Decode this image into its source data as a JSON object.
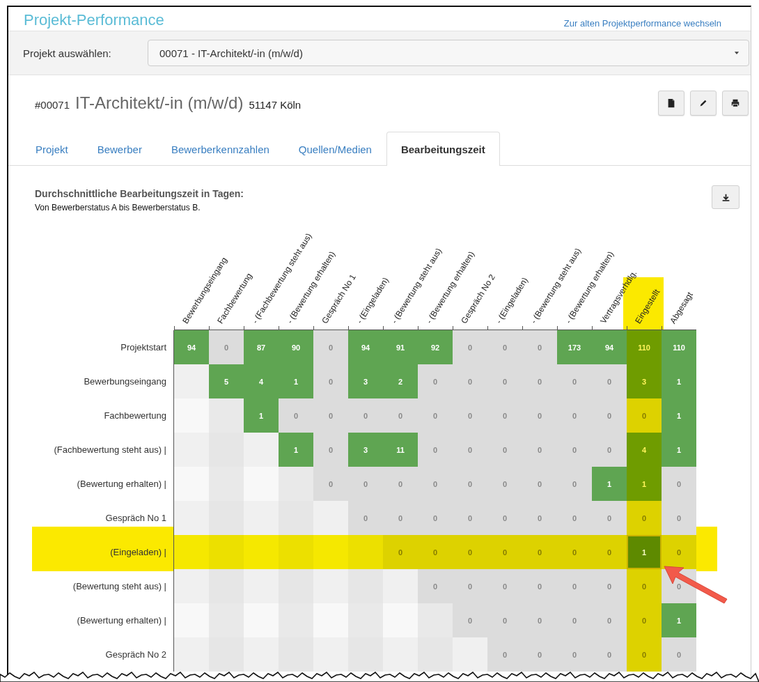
{
  "page": {
    "title": "Projekt-Performance",
    "switch_link": "Zur alten Projektperformance wechseln"
  },
  "project_select": {
    "label": "Projekt auswählen:",
    "value": "00071 - IT-Architekt/-in (m/w/d)"
  },
  "project": {
    "number": "#00071",
    "title": "IT-Architekt/-in (m/w/d)",
    "location": "51147 Köln"
  },
  "toolbar": [
    {
      "kind": "document"
    },
    {
      "kind": "edit"
    },
    {
      "kind": "print"
    }
  ],
  "tabs": [
    {
      "label": "Projekt",
      "selected": false
    },
    {
      "label": "Bewerber",
      "selected": false
    },
    {
      "label": "Bewerberkennzahlen",
      "selected": false
    },
    {
      "label": "Quellen/Medien",
      "selected": false
    },
    {
      "label": "Bearbeitungszeit",
      "selected": true
    }
  ],
  "panel": {
    "title": "Durchschnittliche Bearbeitungszeit in Tagen:",
    "subtitle": "Von Bewerberstatus A bis Bewerberstatus B."
  },
  "matrix": {
    "columns": [
      {
        "label": "Bewerbungseingang",
        "highlighted": false
      },
      {
        "label": "Fachbewertung",
        "highlighted": false
      },
      {
        "label": "- (Fachbewertung steht aus)",
        "highlighted": false
      },
      {
        "label": "- (Bewertung erhalten)",
        "highlighted": false
      },
      {
        "label": "Gespräch No 1",
        "highlighted": false
      },
      {
        "label": "- (Eingeladen)",
        "highlighted": false
      },
      {
        "label": "- (Bewertung steht aus)",
        "highlighted": false
      },
      {
        "label": "- (Bewertung erhalten)",
        "highlighted": false
      },
      {
        "label": "Gespräch No 2",
        "highlighted": false
      },
      {
        "label": "- (Eingeladen)",
        "highlighted": false
      },
      {
        "label": "- (Bewertung steht aus)",
        "highlighted": false
      },
      {
        "label": "- (Bewertung erhalten)",
        "highlighted": false
      },
      {
        "label": "Vertragsverhdlg.",
        "highlighted": false
      },
      {
        "label": "Eingestellt",
        "highlighted": true
      },
      {
        "label": "Abgesagt",
        "highlighted": false
      }
    ],
    "rows": [
      {
        "label": "Projektstart",
        "highlighted": false,
        "cells": [
          {
            "v": "94",
            "kind": "hit"
          },
          {
            "v": "0",
            "kind": "zero"
          },
          {
            "v": "87",
            "kind": "hit"
          },
          {
            "v": "90",
            "kind": "hit"
          },
          {
            "v": "0",
            "kind": "zero"
          },
          {
            "v": "94",
            "kind": "hit"
          },
          {
            "v": "91",
            "kind": "hit"
          },
          {
            "v": "92",
            "kind": "hit"
          },
          {
            "v": "0",
            "kind": "zero"
          },
          {
            "v": "0",
            "kind": "zero"
          },
          {
            "v": "0",
            "kind": "zero"
          },
          {
            "v": "173",
            "kind": "hit"
          },
          {
            "v": "94",
            "kind": "hit"
          },
          {
            "v": "110",
            "kind": "hit"
          },
          {
            "v": "110",
            "kind": "hit"
          }
        ]
      },
      {
        "label": "Bewerbungseingang",
        "highlighted": false,
        "cells": [
          null,
          {
            "v": "5",
            "kind": "hit"
          },
          {
            "v": "4",
            "kind": "hit"
          },
          {
            "v": "1",
            "kind": "hit"
          },
          {
            "v": "0",
            "kind": "zero"
          },
          {
            "v": "3",
            "kind": "hit"
          },
          {
            "v": "2",
            "kind": "hit"
          },
          {
            "v": "0",
            "kind": "zero"
          },
          {
            "v": "0",
            "kind": "zero"
          },
          {
            "v": "0",
            "kind": "zero"
          },
          {
            "v": "0",
            "kind": "zero"
          },
          {
            "v": "0",
            "kind": "zero"
          },
          {
            "v": "0",
            "kind": "zero"
          },
          {
            "v": "3",
            "kind": "hit"
          },
          {
            "v": "1",
            "kind": "hit"
          }
        ]
      },
      {
        "label": "Fachbewertung",
        "highlighted": false,
        "cells": [
          null,
          null,
          {
            "v": "1",
            "kind": "hit"
          },
          {
            "v": "0",
            "kind": "zero"
          },
          {
            "v": "0",
            "kind": "zero"
          },
          {
            "v": "0",
            "kind": "zero"
          },
          {
            "v": "0",
            "kind": "zero"
          },
          {
            "v": "0",
            "kind": "zero"
          },
          {
            "v": "0",
            "kind": "zero"
          },
          {
            "v": "0",
            "kind": "zero"
          },
          {
            "v": "0",
            "kind": "zero"
          },
          {
            "v": "0",
            "kind": "zero"
          },
          {
            "v": "0",
            "kind": "zero"
          },
          {
            "v": "0",
            "kind": "zero"
          },
          {
            "v": "1",
            "kind": "hit"
          }
        ]
      },
      {
        "label": "(Fachbewertung steht aus) |",
        "highlighted": false,
        "cells": [
          null,
          null,
          null,
          {
            "v": "1",
            "kind": "hit"
          },
          {
            "v": "0",
            "kind": "zero"
          },
          {
            "v": "3",
            "kind": "hit"
          },
          {
            "v": "11",
            "kind": "hit"
          },
          {
            "v": "0",
            "kind": "zero"
          },
          {
            "v": "0",
            "kind": "zero"
          },
          {
            "v": "0",
            "kind": "zero"
          },
          {
            "v": "0",
            "kind": "zero"
          },
          {
            "v": "0",
            "kind": "zero"
          },
          {
            "v": "0",
            "kind": "zero"
          },
          {
            "v": "4",
            "kind": "hit"
          },
          {
            "v": "1",
            "kind": "hit"
          }
        ]
      },
      {
        "label": "(Bewertung erhalten) |",
        "highlighted": false,
        "cells": [
          null,
          null,
          null,
          null,
          {
            "v": "0",
            "kind": "zero"
          },
          {
            "v": "0",
            "kind": "zero"
          },
          {
            "v": "0",
            "kind": "zero"
          },
          {
            "v": "0",
            "kind": "zero"
          },
          {
            "v": "0",
            "kind": "zero"
          },
          {
            "v": "0",
            "kind": "zero"
          },
          {
            "v": "0",
            "kind": "zero"
          },
          {
            "v": "0",
            "kind": "zero"
          },
          {
            "v": "1",
            "kind": "hit"
          },
          {
            "v": "1",
            "kind": "hit"
          },
          {
            "v": "0",
            "kind": "zero"
          }
        ]
      },
      {
        "label": "Gespräch No 1",
        "highlighted": false,
        "cells": [
          null,
          null,
          null,
          null,
          null,
          {
            "v": "0",
            "kind": "zero"
          },
          {
            "v": "0",
            "kind": "zero"
          },
          {
            "v": "0",
            "kind": "zero"
          },
          {
            "v": "0",
            "kind": "zero"
          },
          {
            "v": "0",
            "kind": "zero"
          },
          {
            "v": "0",
            "kind": "zero"
          },
          {
            "v": "0",
            "kind": "zero"
          },
          {
            "v": "0",
            "kind": "zero"
          },
          {
            "v": "0",
            "kind": "zero"
          },
          {
            "v": "0",
            "kind": "zero"
          }
        ]
      },
      {
        "label": "(Eingeladen) |",
        "highlighted": true,
        "cells": [
          null,
          null,
          null,
          null,
          null,
          null,
          {
            "v": "0",
            "kind": "zero"
          },
          {
            "v": "0",
            "kind": "zero"
          },
          {
            "v": "0",
            "kind": "zero"
          },
          {
            "v": "0",
            "kind": "zero"
          },
          {
            "v": "0",
            "kind": "zero"
          },
          {
            "v": "0",
            "kind": "zero"
          },
          {
            "v": "0",
            "kind": "zero"
          },
          {
            "v": "1",
            "kind": "hit"
          },
          {
            "v": "0",
            "kind": "zero"
          }
        ]
      },
      {
        "label": "(Bewertung steht aus) |",
        "highlighted": false,
        "cells": [
          null,
          null,
          null,
          null,
          null,
          null,
          null,
          {
            "v": "0",
            "kind": "zero"
          },
          {
            "v": "0",
            "kind": "zero"
          },
          {
            "v": "0",
            "kind": "zero"
          },
          {
            "v": "0",
            "kind": "zero"
          },
          {
            "v": "0",
            "kind": "zero"
          },
          {
            "v": "0",
            "kind": "zero"
          },
          {
            "v": "0",
            "kind": "zero"
          },
          {
            "v": "0",
            "kind": "zero"
          }
        ]
      },
      {
        "label": "(Bewertung erhalten) |",
        "highlighted": false,
        "cells": [
          null,
          null,
          null,
          null,
          null,
          null,
          null,
          null,
          {
            "v": "0",
            "kind": "zero"
          },
          {
            "v": "0",
            "kind": "zero"
          },
          {
            "v": "0",
            "kind": "zero"
          },
          {
            "v": "0",
            "kind": "zero"
          },
          {
            "v": "0",
            "kind": "zero"
          },
          {
            "v": "0",
            "kind": "zero"
          },
          {
            "v": "1",
            "kind": "hit"
          }
        ]
      },
      {
        "label": "Gespräch No 2",
        "highlighted": false,
        "cells": [
          null,
          null,
          null,
          null,
          null,
          null,
          null,
          null,
          null,
          {
            "v": "0",
            "kind": "zero"
          },
          {
            "v": "0",
            "kind": "zero"
          },
          {
            "v": "0",
            "kind": "zero"
          },
          {
            "v": "0",
            "kind": "zero"
          },
          {
            "v": "0",
            "kind": "zero"
          },
          {
            "v": "0",
            "kind": "zero"
          }
        ]
      }
    ]
  }
}
